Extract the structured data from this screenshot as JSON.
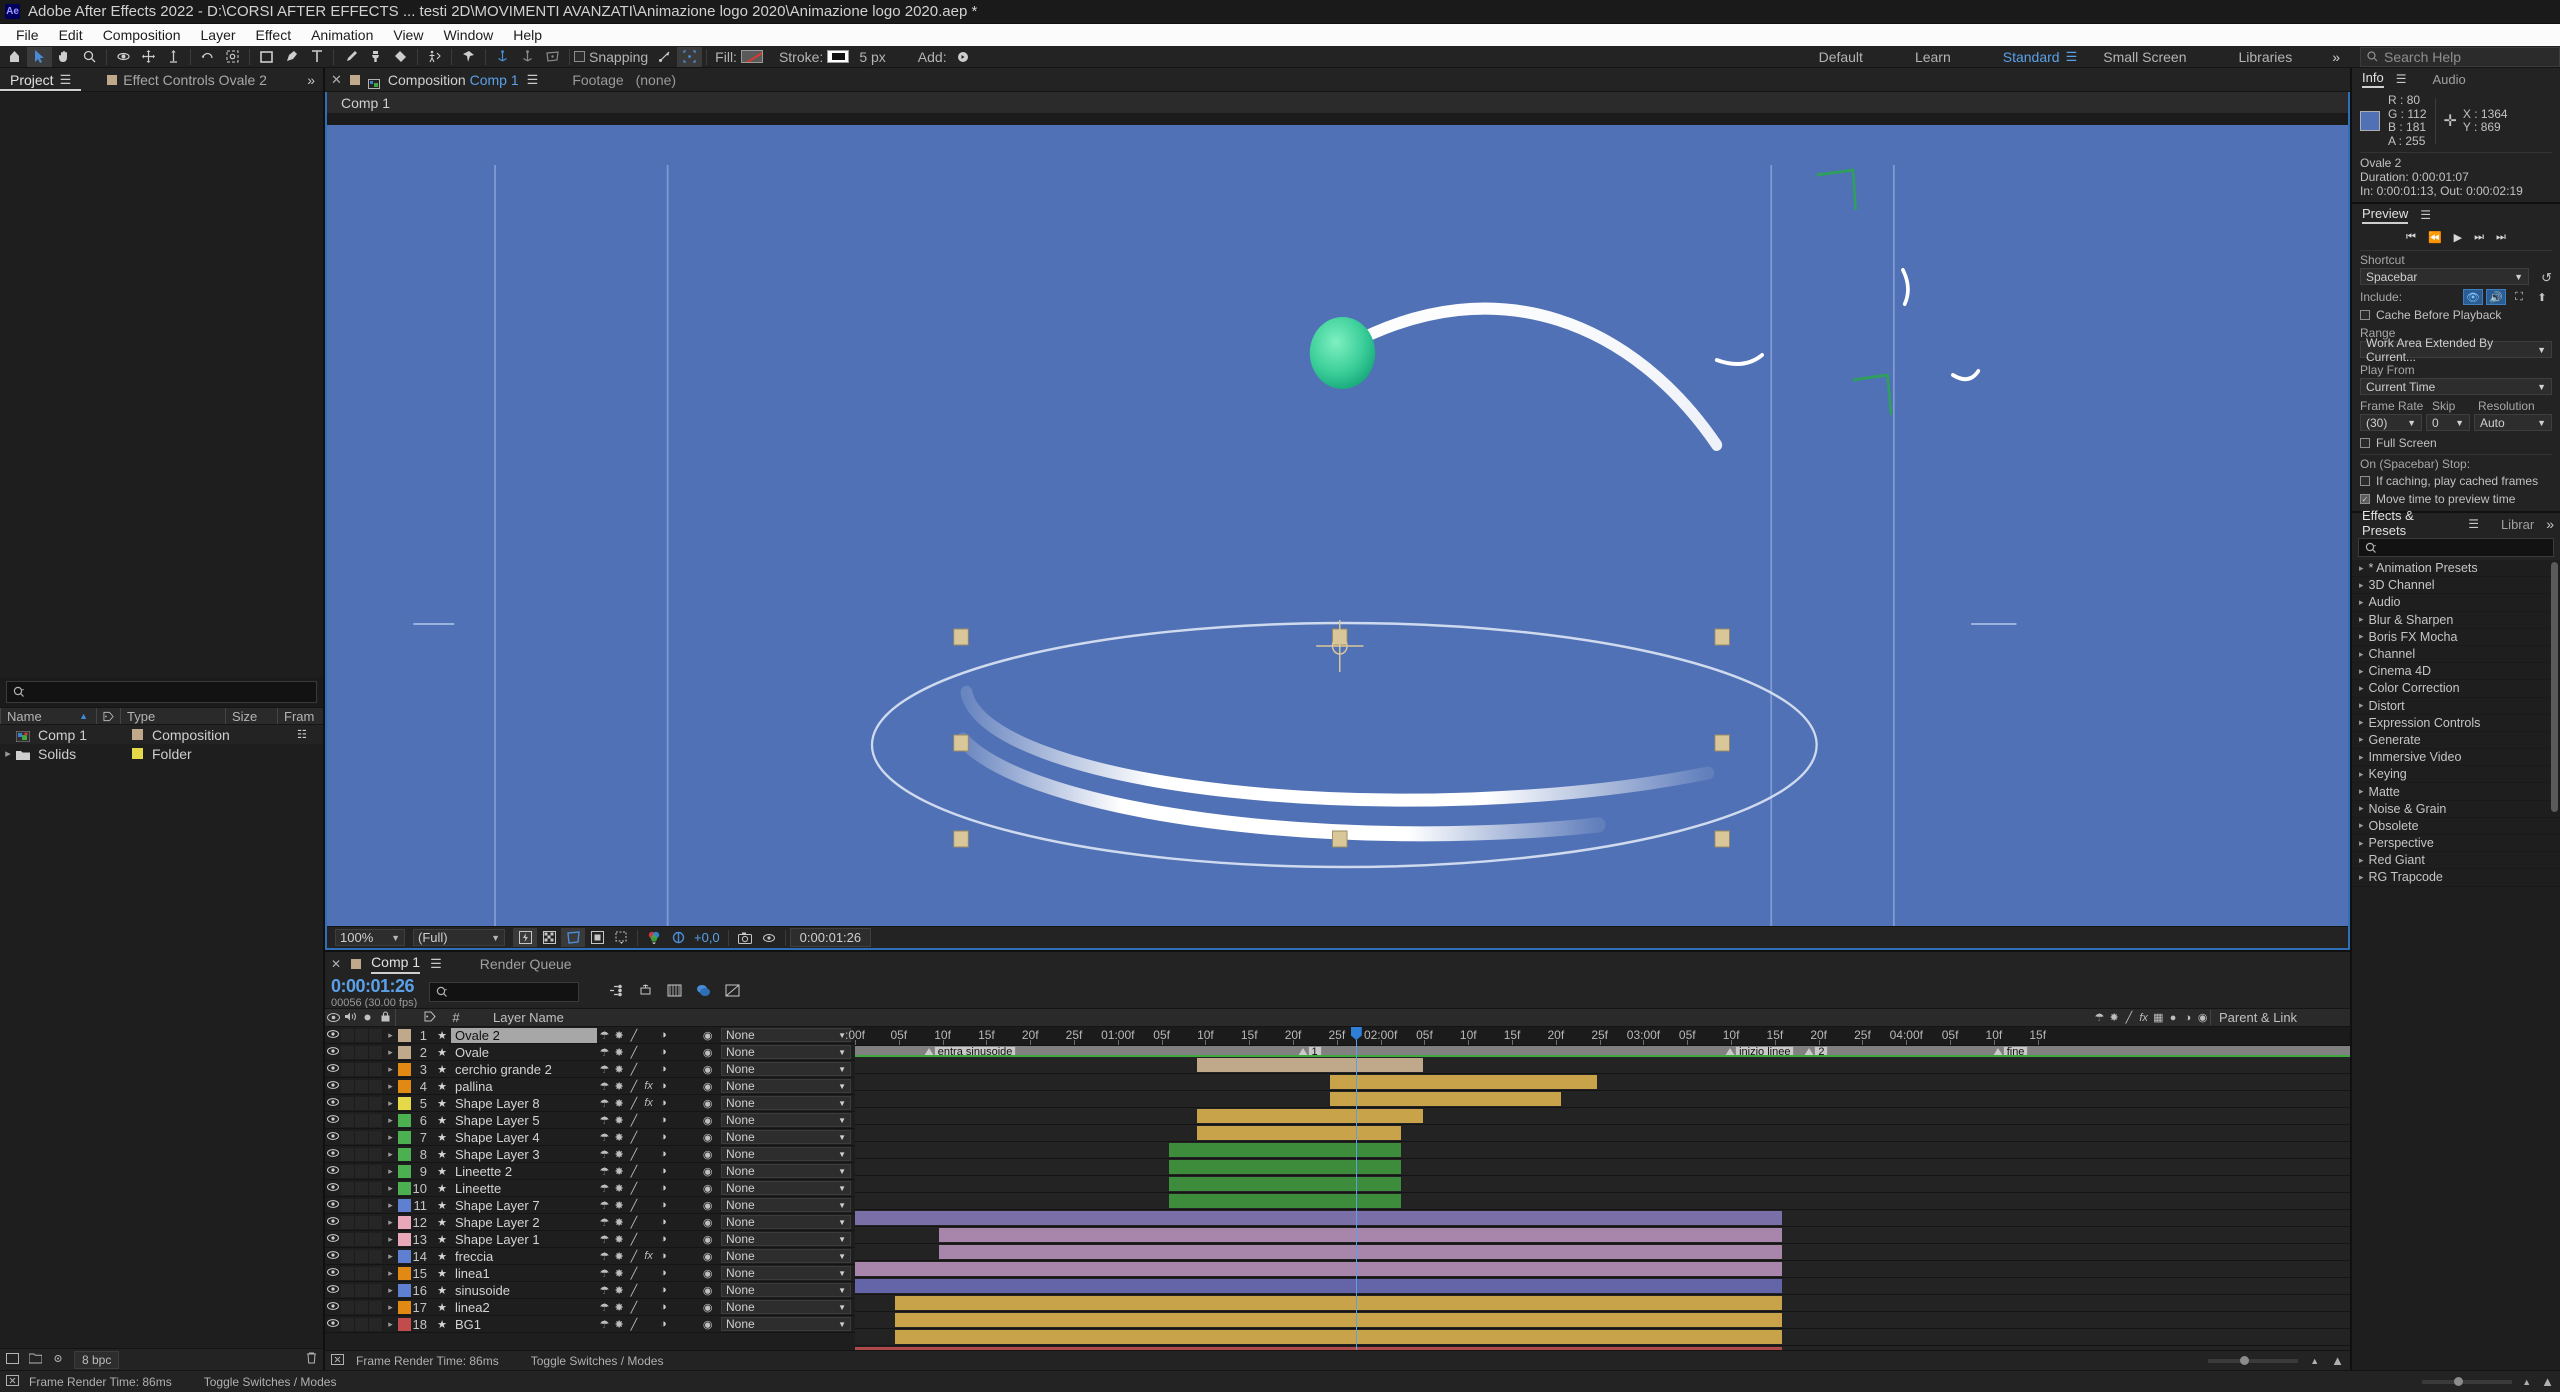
{
  "titlebar": {
    "logo": "Ae",
    "title": "Adobe After Effects 2022 - D:\\CORSI AFTER EFFECTS ... testi 2D\\MOVIMENTI AVANZATI\\Animazione logo 2020\\Animazione logo 2020.aep *"
  },
  "menubar": {
    "items": [
      "File",
      "Edit",
      "Composition",
      "Layer",
      "Effect",
      "Animation",
      "View",
      "Window",
      "Help"
    ]
  },
  "toolbar": {
    "snapping_label": "Snapping",
    "fill_label": "Fill:",
    "stroke_label": "Stroke:",
    "stroke_width": "5 px",
    "add_label": "Add:",
    "workspaces": [
      "Default",
      "Learn",
      "Standard",
      "Small Screen",
      "Libraries"
    ],
    "active_workspace": "Standard",
    "overflow": "»",
    "search_placeholder": "Search Help"
  },
  "project_panel": {
    "tabs": [
      {
        "label": "Project",
        "active": true
      },
      {
        "label": "Effect Controls Ovale 2",
        "active": false
      }
    ],
    "overflow": "»",
    "columns": [
      "Name",
      "Type",
      "Size",
      "Fram"
    ],
    "rows": [
      {
        "name": "Comp 1",
        "type": "Composition",
        "size": "",
        "color": "#bfa98a",
        "icon": "composition-icon"
      },
      {
        "name": "Solids",
        "type": "Folder",
        "size": "",
        "color": "#e5d94a",
        "icon": "folder-icon"
      }
    ],
    "bit_depth": "8 bpc"
  },
  "composition_panel": {
    "tab_label_prefix": "Composition",
    "tab_label": "Comp 1",
    "footage_label": "Footage",
    "footage_value": "(none)",
    "breadcrumb": "Comp 1",
    "zoom": "100%",
    "resolution": "(Full)",
    "exposure": "+0,0",
    "timecode": "0:00:01:26"
  },
  "info_panel": {
    "tabs": [
      "Info",
      "Audio"
    ],
    "active_tab": "Info",
    "swatch_color": "#5071b5",
    "channels": [
      {
        "label": "R :",
        "value": "80"
      },
      {
        "label": "G :",
        "value": "112"
      },
      {
        "label": "B :",
        "value": "181"
      },
      {
        "label": "A :",
        "value": "255"
      }
    ],
    "x": "X : 1364",
    "y": "Y : 869",
    "layer_name": "Ovale 2",
    "duration": "Duration: 0:00:01:07",
    "inout": "In: 0:00:01:13, Out: 0:00:02:19"
  },
  "preview_panel": {
    "title": "Preview",
    "shortcut_label": "Shortcut",
    "shortcut_value": "Spacebar",
    "include_label": "Include:",
    "cache_before_playback": "Cache Before Playback",
    "cache_checked": false,
    "range_label": "Range",
    "range_value": "Work Area Extended By Current...",
    "play_from_label": "Play From",
    "play_from_value": "Current Time",
    "frame_rate_label": "Frame Rate",
    "frame_rate_value": "(30)",
    "skip_label": "Skip",
    "skip_value": "0",
    "resolution_label": "Resolution",
    "resolution_value": "Auto",
    "full_screen": "Full Screen",
    "full_screen_checked": false,
    "on_stop_label": "On (Spacebar) Stop:",
    "if_caching": "If caching, play cached frames",
    "if_caching_checked": false,
    "move_time": "Move time to preview time",
    "move_time_checked": true
  },
  "effects_panel": {
    "tabs": [
      "Effects & Presets",
      "Librar"
    ],
    "active_tab": "Effects & Presets",
    "overflow": "»",
    "categories": [
      "* Animation Presets",
      "3D Channel",
      "Audio",
      "Blur & Sharpen",
      "Boris FX Mocha",
      "Channel",
      "Cinema 4D",
      "Color Correction",
      "Distort",
      "Expression Controls",
      "Generate",
      "Immersive Video",
      "Keying",
      "Matte",
      "Noise & Grain",
      "Obsolete",
      "Perspective",
      "Red Giant",
      "RG Trapcode"
    ]
  },
  "timeline": {
    "tabs": [
      {
        "label": "Comp 1",
        "active": true
      },
      {
        "label": "Render Queue",
        "active": false
      }
    ],
    "current_time": "0:00:01:26",
    "frame_info": "00056 (30.00 fps)",
    "columns": {
      "layer_name": "Layer Name",
      "parent": "Parent & Link",
      "hash": "#"
    },
    "ruler_ticks": [
      {
        "label": ":00f",
        "pos": 0.0
      },
      {
        "label": "05f",
        "pos": 2.93
      },
      {
        "label": "10f",
        "pos": 5.86
      },
      {
        "label": "15f",
        "pos": 8.79
      },
      {
        "label": "20f",
        "pos": 11.72
      },
      {
        "label": "25f",
        "pos": 14.65
      },
      {
        "label": "01:00f",
        "pos": 17.58
      },
      {
        "label": "05f",
        "pos": 20.51
      },
      {
        "label": "10f",
        "pos": 23.44
      },
      {
        "label": "15f",
        "pos": 26.37
      },
      {
        "label": "20f",
        "pos": 29.3
      },
      {
        "label": "25f",
        "pos": 32.23
      },
      {
        "label": "02:00f",
        "pos": 35.16
      },
      {
        "label": "05f",
        "pos": 38.09
      },
      {
        "label": "10f",
        "pos": 41.02
      },
      {
        "label": "15f",
        "pos": 43.95
      },
      {
        "label": "20f",
        "pos": 46.88
      },
      {
        "label": "25f",
        "pos": 49.81
      },
      {
        "label": "03:00f",
        "pos": 52.74
      },
      {
        "label": "05f",
        "pos": 55.67
      },
      {
        "label": "10f",
        "pos": 58.6
      },
      {
        "label": "15f",
        "pos": 61.53
      },
      {
        "label": "20f",
        "pos": 64.46
      },
      {
        "label": "25f",
        "pos": 67.39
      },
      {
        "label": "04:00f",
        "pos": 70.32
      },
      {
        "label": "05f",
        "pos": 73.25
      },
      {
        "label": "10f",
        "pos": 76.18
      },
      {
        "label": "15f",
        "pos": 79.11
      }
    ],
    "markers": [
      {
        "label": "entra sinusoide",
        "pos": 4.6
      },
      {
        "label": "1",
        "pos": 29.6
      },
      {
        "label": "inizio linee",
        "pos": 58.2
      },
      {
        "label": "2",
        "pos": 63.5
      },
      {
        "label": "fine",
        "pos": 76.1
      }
    ],
    "playhead_pos": 33.5,
    "layers": [
      {
        "num": "1",
        "name": "Ovale 2",
        "color": "#bfa98a",
        "selected": true,
        "fx": false,
        "bar_start": 22.9,
        "bar_end": 38.0,
        "bar_color": "#bfa98a"
      },
      {
        "num": "2",
        "name": "Ovale",
        "color": "#bfa98a",
        "selected": false,
        "fx": false,
        "bar_start": 31.8,
        "bar_end": 49.6,
        "bar_color": "#c9a34a"
      },
      {
        "num": "3",
        "name": "cerchio grande 2",
        "color": "#e08a14",
        "selected": false,
        "fx": false,
        "bar_start": 31.8,
        "bar_end": 47.2,
        "bar_color": "#c9a34a"
      },
      {
        "num": "4",
        "name": "pallina",
        "color": "#e08a14",
        "selected": false,
        "fx": true,
        "bar_start": 22.9,
        "bar_end": 38.0,
        "bar_color": "#c9a34a"
      },
      {
        "num": "5",
        "name": "Shape Layer 8",
        "color": "#e5d94a",
        "selected": false,
        "fx": true,
        "bar_start": 22.9,
        "bar_end": 36.5,
        "bar_color": "#c9a34a"
      },
      {
        "num": "6",
        "name": "Shape Layer 5",
        "color": "#4caf50",
        "selected": false,
        "fx": false,
        "bar_start": 21.0,
        "bar_end": 36.5,
        "bar_color": "#3c8c3c"
      },
      {
        "num": "7",
        "name": "Shape Layer 4",
        "color": "#4caf50",
        "selected": false,
        "fx": false,
        "bar_start": 21.0,
        "bar_end": 36.5,
        "bar_color": "#3c8c3c"
      },
      {
        "num": "8",
        "name": "Shape Layer 3",
        "color": "#4caf50",
        "selected": false,
        "fx": false,
        "bar_start": 21.0,
        "bar_end": 36.5,
        "bar_color": "#3c8c3c"
      },
      {
        "num": "9",
        "name": "Lineette 2",
        "color": "#4caf50",
        "selected": false,
        "fx": false,
        "bar_start": 21.0,
        "bar_end": 36.5,
        "bar_color": "#3c8c3c"
      },
      {
        "num": "10",
        "name": "Lineette",
        "color": "#4caf50",
        "selected": false,
        "fx": false,
        "bar_start": 0.0,
        "bar_end": 62.0,
        "bar_color": "#7b6fa8"
      },
      {
        "num": "11",
        "name": "Shape Layer 7",
        "color": "#5f7fd0",
        "selected": false,
        "fx": false,
        "bar_start": 5.6,
        "bar_end": 62.0,
        "bar_color": "#a885ab"
      },
      {
        "num": "12",
        "name": "Shape Layer 2",
        "color": "#e8a8b8",
        "selected": false,
        "fx": false,
        "bar_start": 5.6,
        "bar_end": 62.0,
        "bar_color": "#a885ab"
      },
      {
        "num": "13",
        "name": "Shape Layer 1",
        "color": "#e8a8b8",
        "selected": false,
        "fx": false,
        "bar_start": 0.0,
        "bar_end": 62.0,
        "bar_color": "#a885ab"
      },
      {
        "num": "14",
        "name": "freccia",
        "color": "#5f7fd0",
        "selected": false,
        "fx": true,
        "bar_start": 0.0,
        "bar_end": 62.0,
        "bar_color": "#6464a8"
      },
      {
        "num": "15",
        "name": "linea1",
        "color": "#e08a14",
        "selected": false,
        "fx": false,
        "bar_start": 2.7,
        "bar_end": 62.0,
        "bar_color": "#c9a34a"
      },
      {
        "num": "16",
        "name": "sinusoide",
        "color": "#5f7fd0",
        "selected": false,
        "fx": false,
        "bar_start": 2.7,
        "bar_end": 62.0,
        "bar_color": "#c9a34a"
      },
      {
        "num": "17",
        "name": "linea2",
        "color": "#e08a14",
        "selected": false,
        "fx": false,
        "bar_start": 2.7,
        "bar_end": 62.0,
        "bar_color": "#c9a34a"
      },
      {
        "num": "18",
        "name": "BG1",
        "color": "#c24b4b",
        "selected": false,
        "fx": false,
        "bar_start": 0.0,
        "bar_end": 62.0,
        "bar_color": "#b04a4a"
      }
    ],
    "parent_value": "None",
    "footer": {
      "render_time": "Frame Render Time: 86ms",
      "switches": "Toggle Switches / Modes"
    }
  }
}
